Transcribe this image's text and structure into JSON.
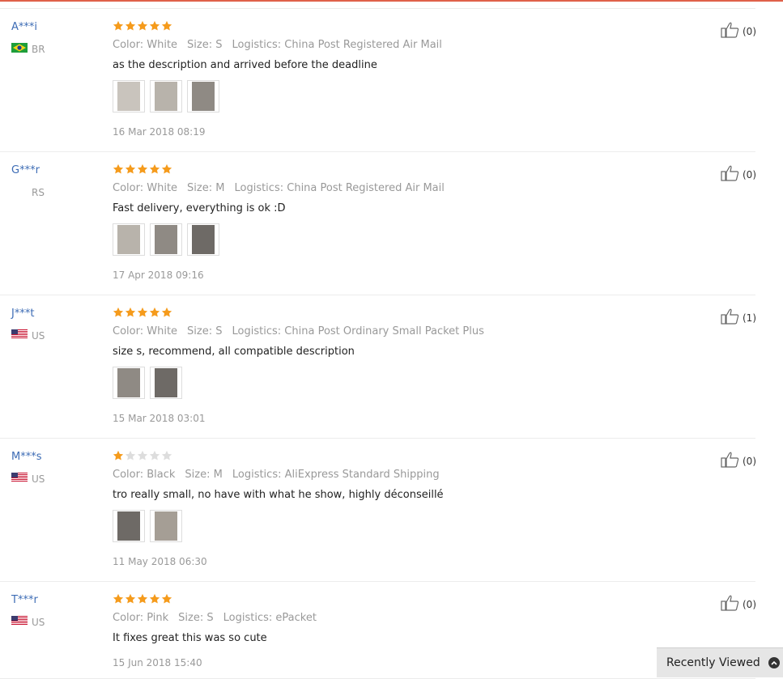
{
  "labels": {
    "color_prefix": "Color:",
    "size_prefix": "Size:",
    "logistics_prefix": "Logistics:"
  },
  "reviews": [
    {
      "user": "A***i",
      "country": "BR",
      "flag": "brazil-flag-icon",
      "rating": 5,
      "color": "White",
      "size": "S",
      "logistics": "China Post Registered Air Mail",
      "text": "as the description and arrived before the deadline",
      "photos": 3,
      "date": "16 Mar 2018 08:19",
      "helpful": "(0)"
    },
    {
      "user": "G***r",
      "country": "RS",
      "flag": "",
      "rating": 5,
      "color": "White",
      "size": "M",
      "logistics": "China Post Registered Air Mail",
      "text": "Fast delivery, everything is ok :D",
      "photos": 3,
      "date": "17 Apr 2018 09:16",
      "helpful": "(0)"
    },
    {
      "user": "J***t",
      "country": "US",
      "flag": "us-flag-icon",
      "rating": 5,
      "color": "White",
      "size": "S",
      "logistics": "China Post Ordinary Small Packet Plus",
      "text": "size s, recommend, all compatible description",
      "photos": 2,
      "date": "15 Mar 2018 03:01",
      "helpful": "(1)"
    },
    {
      "user": "M***s",
      "country": "US",
      "flag": "us-flag-icon",
      "rating": 1,
      "color": "Black",
      "size": "M",
      "logistics": "AliExpress Standard Shipping",
      "text": "tro really small, no have with what he show, highly déconseillé",
      "photos": 2,
      "date": "11 May 2018 06:30",
      "helpful": "(0)"
    },
    {
      "user": "T***r",
      "country": "US",
      "flag": "us-flag-icon",
      "rating": 5,
      "color": "Pink",
      "size": "S",
      "logistics": "ePacket",
      "text": "It fixes great this was so cute",
      "photos": 0,
      "date": "15 Jun 2018 15:40",
      "helpful": "(0)"
    }
  ],
  "recently_viewed": {
    "label": "Recently Viewed"
  },
  "colors": {
    "accent_top": "#e0614a",
    "star": "#f59b1c",
    "star_empty": "#dddddd",
    "user_link": "#3d6cb5"
  }
}
